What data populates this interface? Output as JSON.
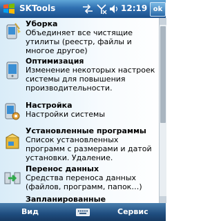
{
  "titlebar": {
    "app_title": "SKTools",
    "clock": "12:19",
    "ok_label": "ok",
    "icons": [
      "windows-start-icon",
      "sync-arrows-icon",
      "signal-off-icon",
      "volume-icon"
    ]
  },
  "items": [
    {
      "title": "Уборка",
      "desc": "Объединяет все чистящие утилиты (реестр, файлы и многое другое)",
      "icon": "broom-pda-icon"
    },
    {
      "title": "Оптимизация",
      "desc": "Изменение некоторых настроек системы для повышения производительности.",
      "icon": "pda-icon"
    },
    {
      "title": "Настройка",
      "desc": "Настройки системы",
      "icon": "pda-gear-icon"
    },
    {
      "title": "Установленные программы",
      "desc": "Список установленных программ с размерами и датой установки. Удаление.",
      "icon": "installer-box-icon"
    },
    {
      "title": "Перенос данных",
      "desc": "Средства переноса данных (файлов, программ, папок…)",
      "icon": "transfer-arrow-icon"
    },
    {
      "title": "Запланированные",
      "desc": "",
      "icon": "schedule-icon"
    }
  ],
  "menubar": {
    "left_label": "Вид",
    "right_label": "Сервис",
    "center_icon": "keyboard-icon"
  },
  "colors": {
    "titlebar": "#2f6fb0",
    "menubar": "#1f4d7f",
    "content_bg": "#d9ecf8"
  }
}
